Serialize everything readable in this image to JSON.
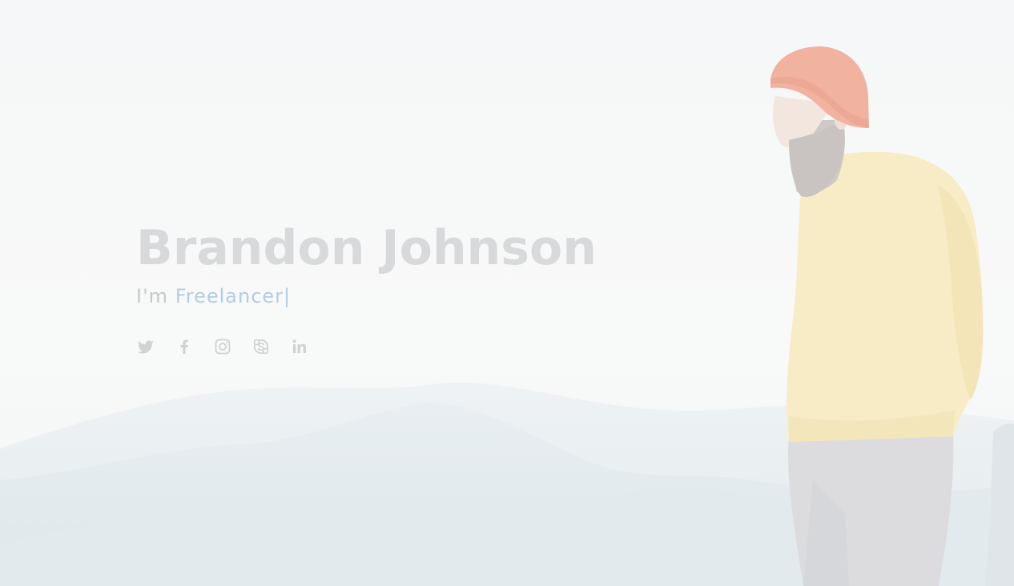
{
  "hero": {
    "name": "Brandon Johnson",
    "intro": "I'm ",
    "typed_role": "Freelancer",
    "cursor": "|"
  },
  "social_links": [
    {
      "icon": "twitter-icon"
    },
    {
      "icon": "facebook-icon"
    },
    {
      "icon": "instagram-icon"
    },
    {
      "icon": "skype-icon"
    },
    {
      "icon": "linkedin-icon"
    }
  ],
  "colors": {
    "name": "#d8d9da",
    "intro": "#c6c8ca",
    "accent": "#b4cce3",
    "icons": "#cfd1d3",
    "hat": "#f1b2a0",
    "sweater": "#f7ecc6",
    "pants": "#dcdcdf",
    "mountains": "#e7edf0"
  }
}
